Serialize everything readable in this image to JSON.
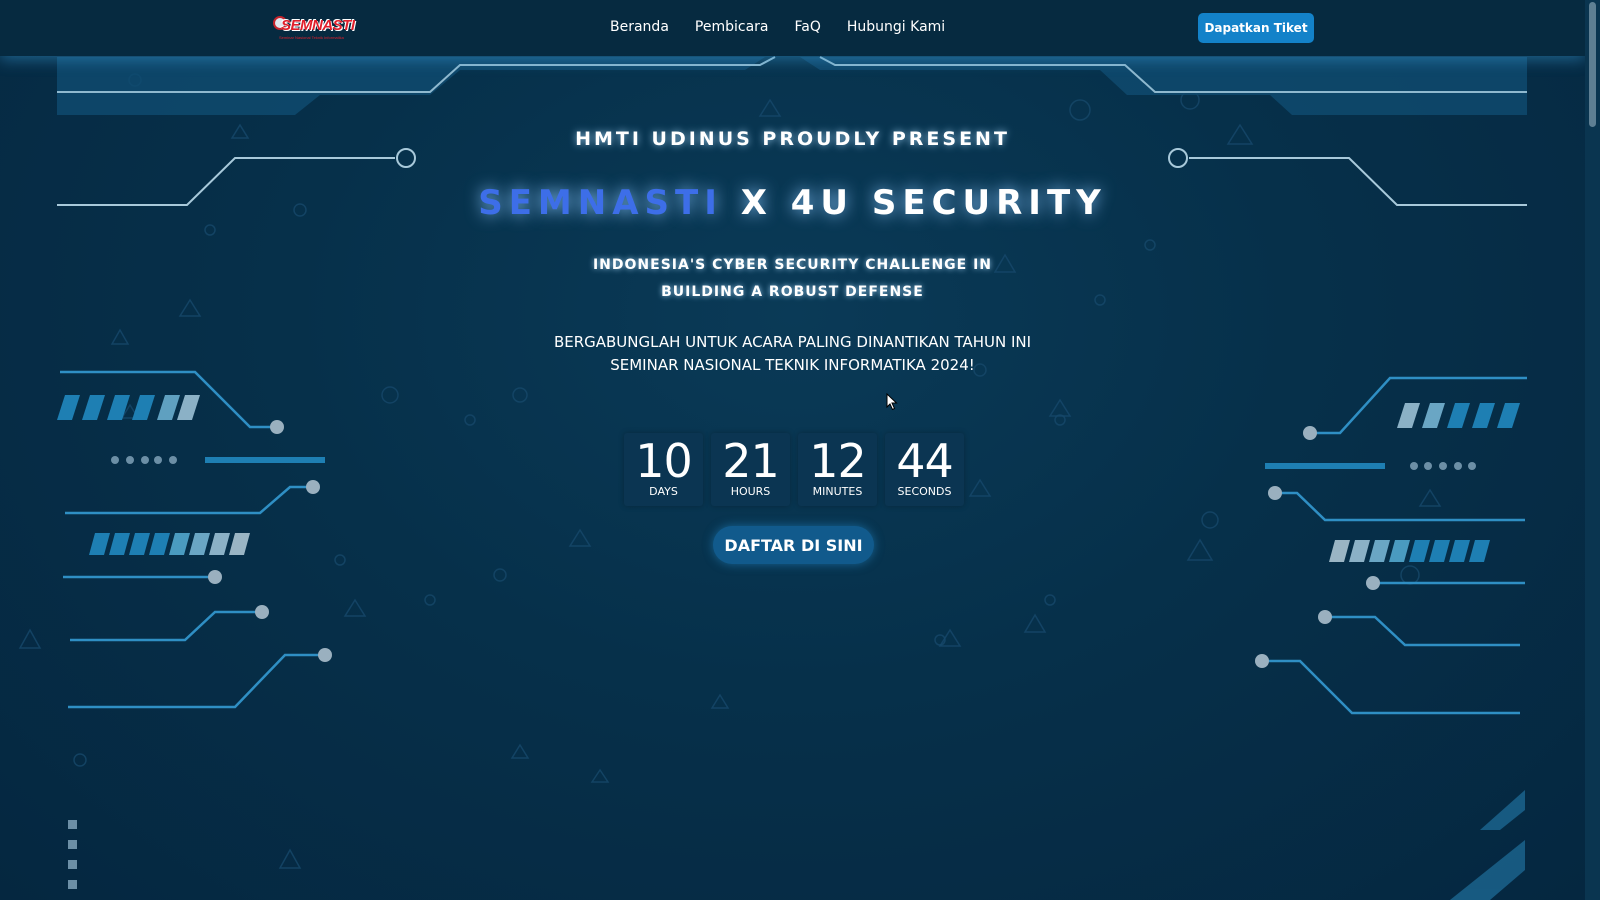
{
  "nav": {
    "logo_text": "SEMNASTI",
    "logo_tagline": "Seminar Nasional Teknik Informatika",
    "items": [
      {
        "label": "Beranda"
      },
      {
        "label": "Pembicara"
      },
      {
        "label": "FaQ"
      },
      {
        "label": "Hubungi Kami"
      }
    ],
    "ticket_button": "Dapatkan Tiket"
  },
  "hero": {
    "presenter": "HMTI UDINUS PROUDLY PRESENT",
    "title_part1": "SEMNASTI",
    "title_part2": " X 4U SECURITY",
    "subtitle": "INDONESIA'S CYBER SECURITY CHALLENGE IN BUILDING A ROBUST DEFENSE",
    "tagline_line1": "BERGABUNGLAH UNTUK ACARA PALING DINANTIKAN TAHUN INI",
    "tagline_line2": "SEMINAR NASIONAL TEKNIK INFORMATIKA 2024!",
    "cta": "DAFTAR DI SINI"
  },
  "countdown": [
    {
      "value": "10",
      "label": "DAYS"
    },
    {
      "value": "21",
      "label": "HOURS"
    },
    {
      "value": "12",
      "label": "MINUTES"
    },
    {
      "value": "44",
      "label": "SECONDS"
    }
  ],
  "colors": {
    "background": "#062a40",
    "accent": "#1382c9",
    "title_blue": "#3d6ee8",
    "circuit": "#2f8fc4"
  }
}
